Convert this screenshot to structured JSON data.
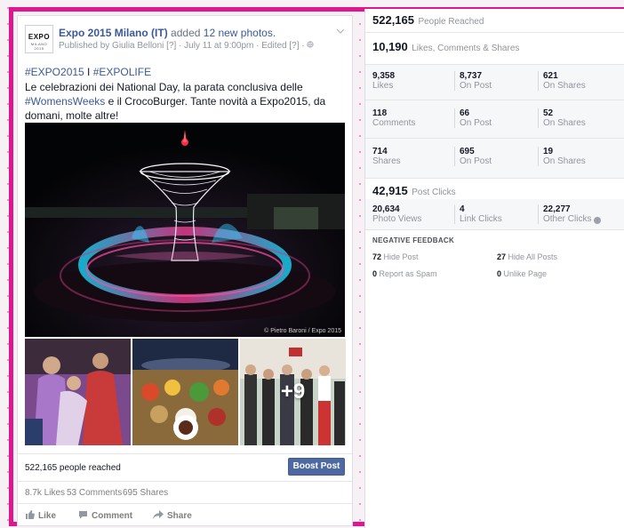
{
  "post": {
    "page_name": "Expo 2015 Milano (IT)",
    "added_text": "added",
    "photo_count_text": "12 new photos.",
    "meta_line": "Published by Giulia Belloni [?] · July 11 at 9:00pm · Edited [?] ·",
    "logo_text": "EXPO",
    "logo_sub": "MILANO 2015",
    "hashtag1": "#EXPO2015",
    "hashtag_sep": " I ",
    "hashtag2": "#EXPOLIFE",
    "text_part1": "Le celebrazioni dei National Day, la parata conclusiva delle ",
    "text_tag": "#WomensWeeks",
    "text_part2": " e il CrocoBurger. Tante novità a Expo2015, da domani, molte altre!",
    "photo_credit": "© Pietro Baroni / Expo 2015",
    "more_photos": "+9",
    "reach": "522,165 people reached",
    "boost_label": "Boost Post",
    "likes_count": "8.7k Likes",
    "comments_count": "53 Comments",
    "shares_count": "695 Shares",
    "action_like": "Like",
    "action_comment": "Comment",
    "action_share": "Share"
  },
  "insights": {
    "people_reached": {
      "value": "522,165",
      "label": "People Reached"
    },
    "engagement": {
      "value": "10,190",
      "label": "Likes, Comments & Shares"
    },
    "likes": [
      {
        "value": "9,358",
        "label": "Likes"
      },
      {
        "value": "8,737",
        "label": "On Post"
      },
      {
        "value": "621",
        "label": "On Shares"
      }
    ],
    "comments": [
      {
        "value": "118",
        "label": "Comments"
      },
      {
        "value": "66",
        "label": "On Post"
      },
      {
        "value": "52",
        "label": "On Shares"
      }
    ],
    "shares": [
      {
        "value": "714",
        "label": "Shares"
      },
      {
        "value": "695",
        "label": "On Post"
      },
      {
        "value": "19",
        "label": "On Shares"
      }
    ],
    "post_clicks": {
      "value": "42,915",
      "label": "Post Clicks"
    },
    "clicks": [
      {
        "value": "20,634",
        "label": "Photo Views"
      },
      {
        "value": "4",
        "label": "Link Clicks"
      },
      {
        "value": "22,277",
        "label": "Other Clicks"
      }
    ],
    "negative_title": "NEGATIVE FEEDBACK",
    "negative": [
      {
        "value": "72",
        "label": "Hide Post"
      },
      {
        "value": "27",
        "label": "Hide All Posts"
      },
      {
        "value": "0",
        "label": "Report as Spam"
      },
      {
        "value": "0",
        "label": "Unlike Page"
      }
    ]
  },
  "colors": {
    "accent": "#3b5998",
    "boost": "#4e69a2",
    "frame": "#e0168f"
  },
  "icons": {
    "like": "thumbs-up-icon",
    "comment": "comment-icon",
    "share": "share-arrow-icon",
    "chevron": "chevron-down-icon",
    "info": "info-icon",
    "globe": "globe-icon"
  }
}
